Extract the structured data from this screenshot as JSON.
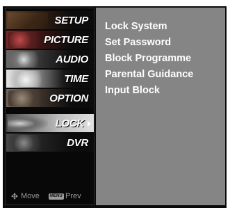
{
  "sidebar": {
    "items": [
      {
        "label": "SETUP",
        "thumb": "setup-wood-image",
        "selected": false
      },
      {
        "label": "PICTURE",
        "thumb": "picture-film-image",
        "selected": false
      },
      {
        "label": "AUDIO",
        "thumb": "audio-speaker-image",
        "selected": false
      },
      {
        "label": "TIME",
        "thumb": "time-clock-image",
        "selected": false
      },
      {
        "label": "OPTION",
        "thumb": "option-tag-image",
        "selected": false
      },
      {
        "label": "LOCK",
        "thumb": "lock-image",
        "selected": true
      },
      {
        "label": "DVR",
        "thumb": "dvr-disc-image",
        "selected": false
      }
    ]
  },
  "footer": {
    "move_icon": "move-arrows-icon",
    "move_label": "Move",
    "menu_key": "MENU",
    "prev_label": "Prev"
  },
  "content": {
    "items": [
      "Lock System",
      "Set Password",
      "Block Programme",
      "Parental Guidance",
      "Input Block"
    ]
  },
  "colors": {
    "sidebar_bg": "#080808",
    "content_bg": "#858585",
    "text": "#ffffff",
    "footer_text": "#9a9a9a"
  }
}
